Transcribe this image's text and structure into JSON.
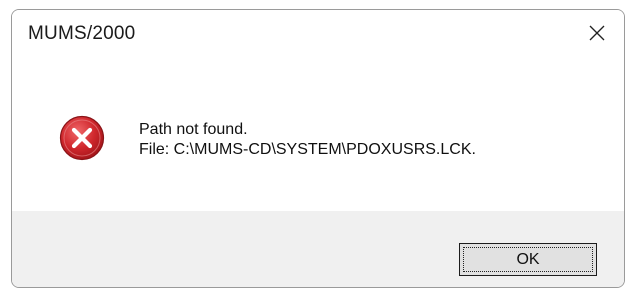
{
  "window": {
    "title": "MUMS/2000"
  },
  "icons": {
    "close": "close-icon",
    "error": "error-icon",
    "error_color": "#c8262b"
  },
  "message": {
    "line1": "Path not found.",
    "line2": "File: C:\\MUMS-CD\\SYSTEM\\PDOXUSRS.LCK."
  },
  "buttons": {
    "ok_label": "OK"
  }
}
